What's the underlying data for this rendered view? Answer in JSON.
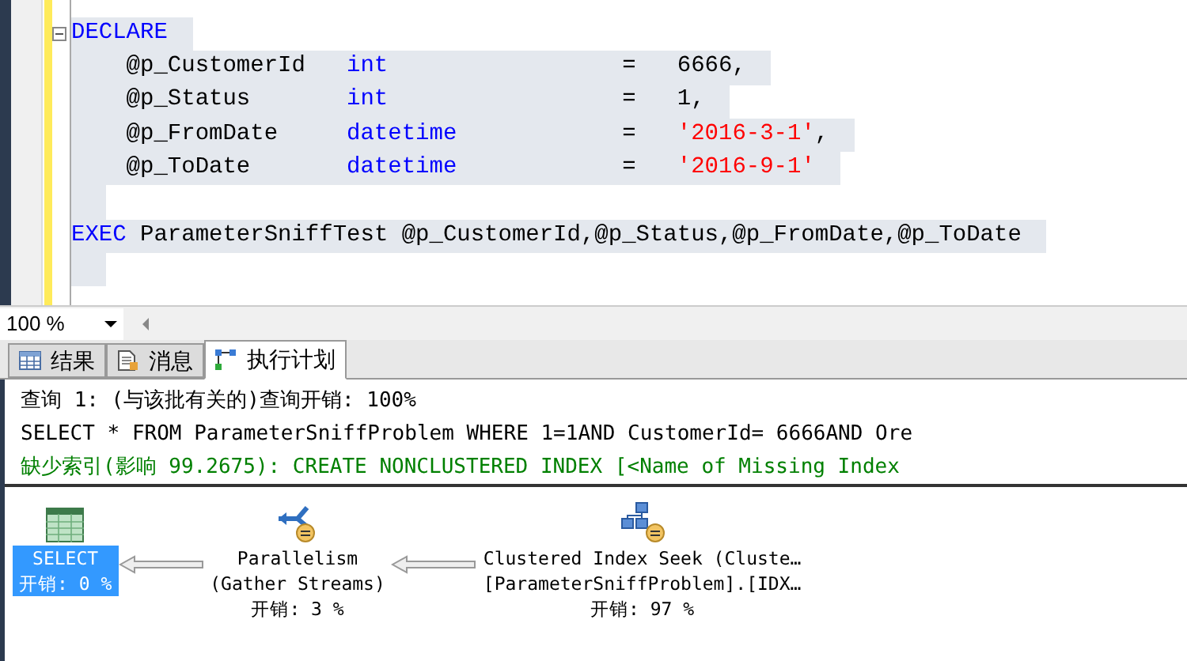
{
  "editor": {
    "lines": [
      {
        "tokens": [
          {
            "kind": "keyword",
            "text": "DECLARE"
          }
        ],
        "collapse": true
      },
      {
        "tokens": [
          {
            "kind": "plain",
            "text": "    @p_CustomerId   "
          },
          {
            "kind": "keyword",
            "text": "int"
          },
          {
            "kind": "plain",
            "text": "                 =   6666,"
          }
        ]
      },
      {
        "tokens": [
          {
            "kind": "plain",
            "text": "    @p_Status       "
          },
          {
            "kind": "keyword",
            "text": "int"
          },
          {
            "kind": "plain",
            "text": "                 =   1,"
          }
        ]
      },
      {
        "tokens": [
          {
            "kind": "plain",
            "text": "    @p_FromDate     "
          },
          {
            "kind": "keyword",
            "text": "datetime"
          },
          {
            "kind": "plain",
            "text": "            =   "
          },
          {
            "kind": "string",
            "text": "'2016-3-1'"
          },
          {
            "kind": "plain",
            "text": ","
          }
        ]
      },
      {
        "tokens": [
          {
            "kind": "plain",
            "text": "    @p_ToDate       "
          },
          {
            "kind": "keyword",
            "text": "datetime"
          },
          {
            "kind": "plain",
            "text": "            =   "
          },
          {
            "kind": "string",
            "text": "'2016-9-1'"
          }
        ]
      },
      {
        "blank": true
      },
      {
        "tokens": [
          {
            "kind": "keyword",
            "text": "EXEC"
          },
          {
            "kind": "plain",
            "text": " ParameterSniffTest @p_CustomerId,@p_Status,@p_FromDate,@p_ToDate"
          }
        ]
      },
      {
        "blank": true
      }
    ]
  },
  "zoom": {
    "value": "100 %"
  },
  "tabs": [
    {
      "label": "结果",
      "selected": false
    },
    {
      "label": "消息",
      "selected": false
    },
    {
      "label": "执行计划",
      "selected": true
    }
  ],
  "results": {
    "lines": [
      {
        "kind": "header",
        "text": "查询 1: (与该批有关的)查询开销: 100%"
      },
      {
        "kind": "sql",
        "text": "SELECT * FROM ParameterSniffProblem WHERE 1=1AND CustomerId= 6666AND Ore"
      },
      {
        "kind": "hint",
        "text": "缺少索引(影响 99.2675): CREATE NONCLUSTERED INDEX [<Name of Missing Index"
      }
    ]
  },
  "plan": {
    "nodes": [
      {
        "kind": "select",
        "lines": [
          "SELECT"
        ],
        "cost": "开销: 0 %",
        "selected": true
      },
      {
        "kind": "parallelism",
        "lines": [
          "Parallelism",
          "(Gather Streams)"
        ],
        "cost": "开销: 3 %",
        "selected": false
      },
      {
        "kind": "seek",
        "lines": [
          "Clustered Index Seek (Cluste…",
          "[ParameterSniffProblem].[IDX…"
        ],
        "cost": "开销: 97 %",
        "selected": false
      }
    ]
  }
}
